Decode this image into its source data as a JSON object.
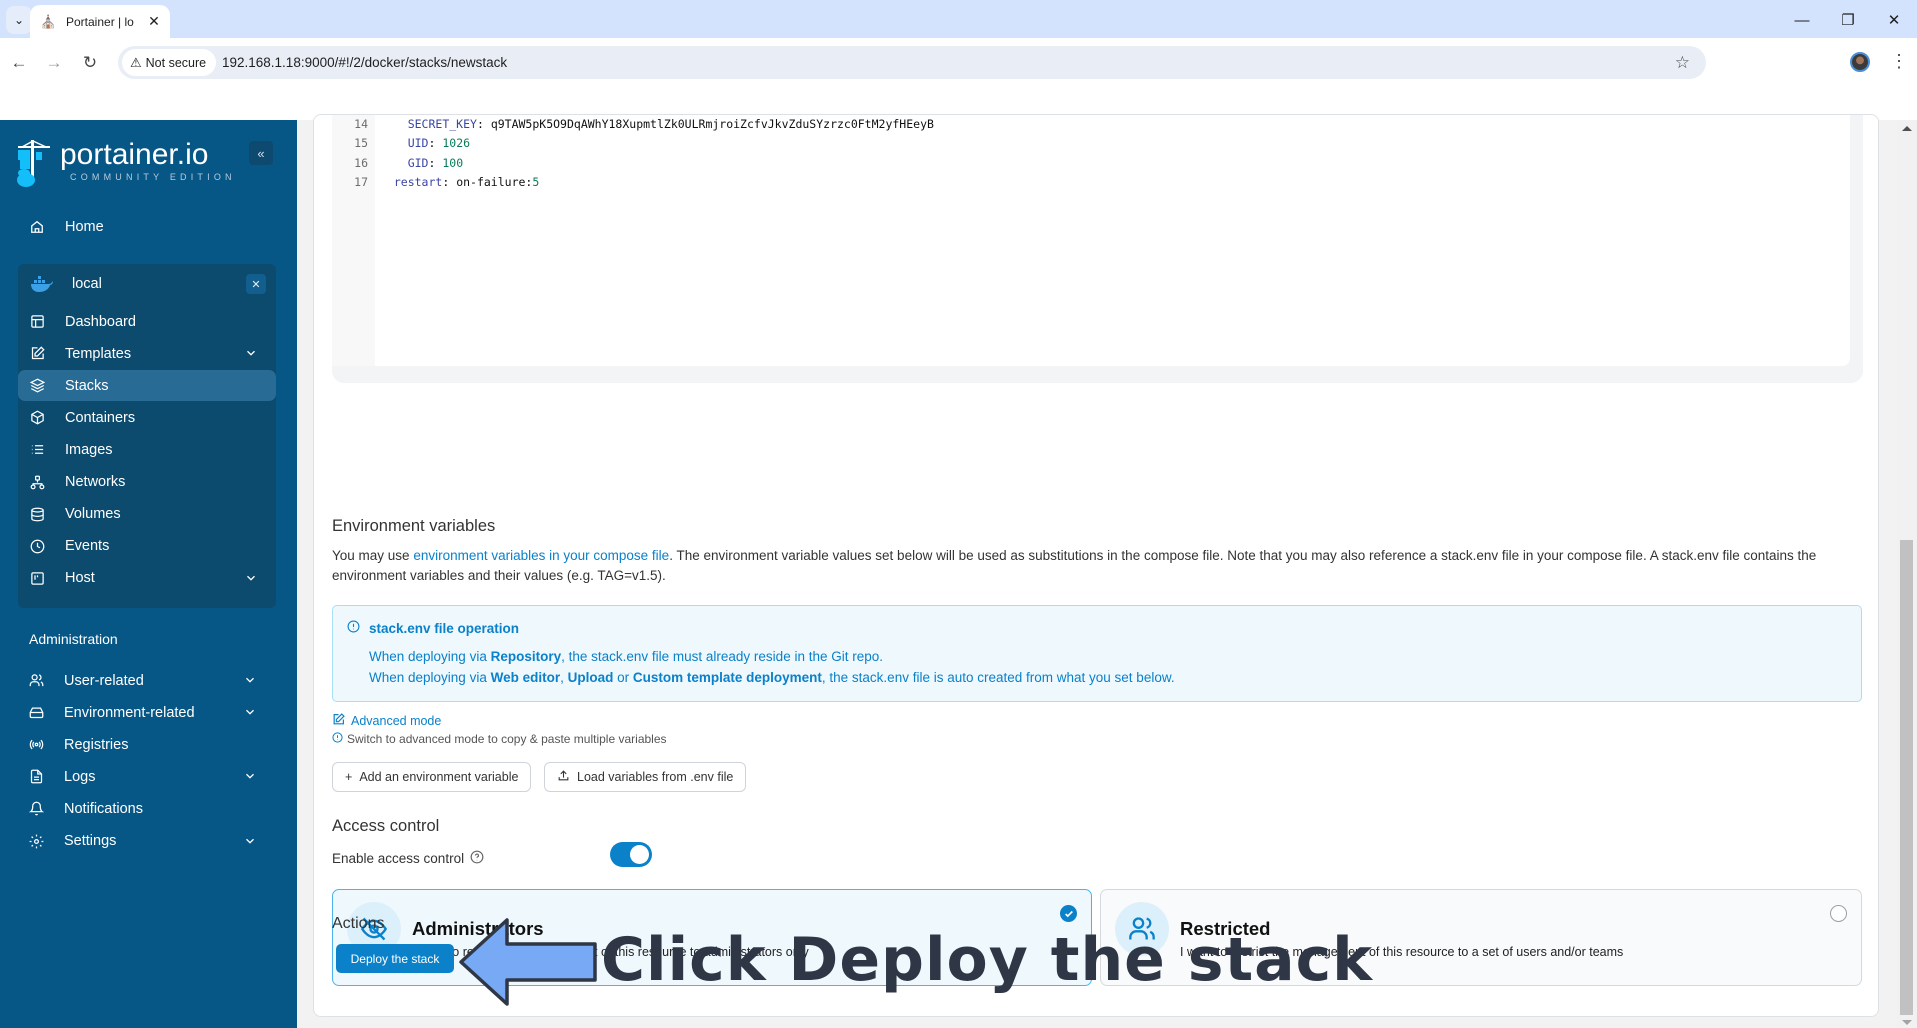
{
  "browser": {
    "tab_title": "Portainer | lo",
    "security_label": "Not secure",
    "url": "192.168.1.18:9000/#!/2/docker/stacks/newstack"
  },
  "sidebar": {
    "logo_name": "portainer.io",
    "logo_edition": "COMMUNITY EDITION",
    "home_label": "Home",
    "environment": {
      "name": "local",
      "items": [
        {
          "label": "Dashboard",
          "icon": "dashboard-icon",
          "expandable": false,
          "active": false
        },
        {
          "label": "Templates",
          "icon": "edit-icon",
          "expandable": true,
          "active": false
        },
        {
          "label": "Stacks",
          "icon": "layers-icon",
          "expandable": false,
          "active": true
        },
        {
          "label": "Containers",
          "icon": "box-icon",
          "expandable": false,
          "active": false
        },
        {
          "label": "Images",
          "icon": "list-icon",
          "expandable": false,
          "active": false
        },
        {
          "label": "Networks",
          "icon": "network-icon",
          "expandable": false,
          "active": false
        },
        {
          "label": "Volumes",
          "icon": "database-icon",
          "expandable": false,
          "active": false
        },
        {
          "label": "Events",
          "icon": "clock-icon",
          "expandable": false,
          "active": false
        },
        {
          "label": "Host",
          "icon": "host-icon",
          "expandable": true,
          "active": false
        }
      ]
    },
    "admin_title": "Administration",
    "admin_items": [
      {
        "label": "User-related",
        "icon": "users-icon",
        "expandable": true
      },
      {
        "label": "Environment-related",
        "icon": "hard-drive-icon",
        "expandable": true
      },
      {
        "label": "Registries",
        "icon": "radio-icon",
        "expandable": false
      },
      {
        "label": "Logs",
        "icon": "file-text-icon",
        "expandable": true
      },
      {
        "label": "Notifications",
        "icon": "bell-icon",
        "expandable": false
      },
      {
        "label": "Settings",
        "icon": "settings-icon",
        "expandable": true
      }
    ]
  },
  "editor": {
    "lines": [
      {
        "n": "14",
        "indent": "  ",
        "key": "SECRET_KEY",
        "value": "q9TAW5pK5O9DqAWhY18XupmtlZk0ULRmjroiZcfvJkvZduSYzrzc0FtM2yfHEeyB",
        "value_type": "string"
      },
      {
        "n": "15",
        "indent": "  ",
        "key": "UID",
        "value": "1026",
        "value_type": "number"
      },
      {
        "n": "16",
        "indent": "  ",
        "key": "GID",
        "value": "100",
        "value_type": "number"
      },
      {
        "n": "17",
        "indent": "",
        "key": "restart",
        "value": "on-failure:5",
        "value_type": "mixed"
      }
    ]
  },
  "env_vars": {
    "title": "Environment variables",
    "desc_before": "You may use ",
    "desc_link": "environment variables in your compose file",
    "desc_after": ". The environment variable values set below will be used as substitutions in the compose file. Note that you may also reference a stack.env file in your compose file. A stack.env file contains the environment variables and their values (e.g. TAG=v1.5).",
    "info": {
      "title": "stack.env file operation",
      "line1": {
        "a": "When deploying via ",
        "b": "Repository",
        "c": ", the stack.env file must already reside in the Git repo."
      },
      "line2": {
        "a": "When deploying via ",
        "b": "Web editor",
        "c": ", ",
        "d": "Upload",
        "e": " or ",
        "f": "Custom template deployment",
        "g": ", the stack.env file is auto created from what you set below."
      }
    },
    "advanced_mode": "Advanced mode",
    "advanced_hint": "Switch to advanced mode to copy & paste multiple variables",
    "add_button": "Add an environment variable",
    "load_button": "Load variables from .env file"
  },
  "access_control": {
    "title": "Access control",
    "enable_label": "Enable access control",
    "enabled": true,
    "options": [
      {
        "title": "Administrators",
        "desc": "I want to restrict the management of this resource to administrators only",
        "selected": true
      },
      {
        "title": "Restricted",
        "desc": "I want to restrict the management of this resource to a set of users and/or teams",
        "selected": false
      }
    ]
  },
  "actions": {
    "title": "Actions",
    "deploy_button": "Deploy the stack"
  },
  "annotation": {
    "text": "Click Deploy the stack"
  },
  "colors": {
    "sidebar_bg": "#065686",
    "sidebar_env_bg": "#0c4a6e",
    "accent": "#0a81c9",
    "annotation_arrow": "#78a9f5",
    "annotation_text": "#2f3645"
  }
}
